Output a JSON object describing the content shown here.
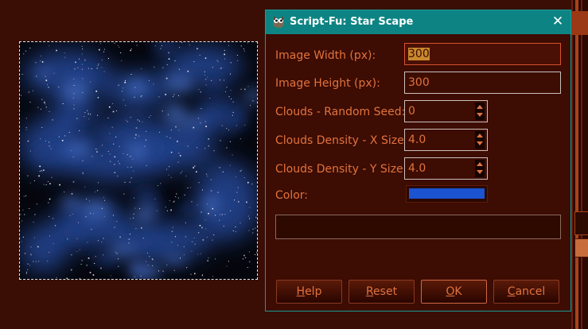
{
  "dialog": {
    "title": "Script-Fu: Star Scape",
    "close_glyph": "✕",
    "fields": {
      "image_width": {
        "label": "Image Width (px):",
        "value": "300"
      },
      "image_height": {
        "label": "Image Height (px):",
        "value": "300"
      },
      "random_seed": {
        "label": "Clouds - Random Seed:",
        "value": "0"
      },
      "density_x": {
        "label": "Clouds Density - X Size:",
        "value": "4.0"
      },
      "density_y": {
        "label": "Clouds Density - Y Size:",
        "value": "4.0"
      },
      "color": {
        "label": "Color:",
        "value": "#1b53d1"
      }
    },
    "buttons": {
      "help": {
        "mnemonic": "H",
        "rest": "elp"
      },
      "reset": {
        "mnemonic": "R",
        "rest": "eset"
      },
      "ok": {
        "mnemonic": "O",
        "rest": "K"
      },
      "cancel": {
        "mnemonic": "C",
        "rest": "ancel"
      }
    }
  },
  "colors": {
    "background": "#3a0e04",
    "dialog_bg": "#3d0c02",
    "titlebar": "#0d8483",
    "label_text": "#e0733e",
    "nebula_blue": "#2a4fa8"
  },
  "icons": {
    "title_icon": "gimp-wilber-icon",
    "close_icon": "close-icon"
  }
}
